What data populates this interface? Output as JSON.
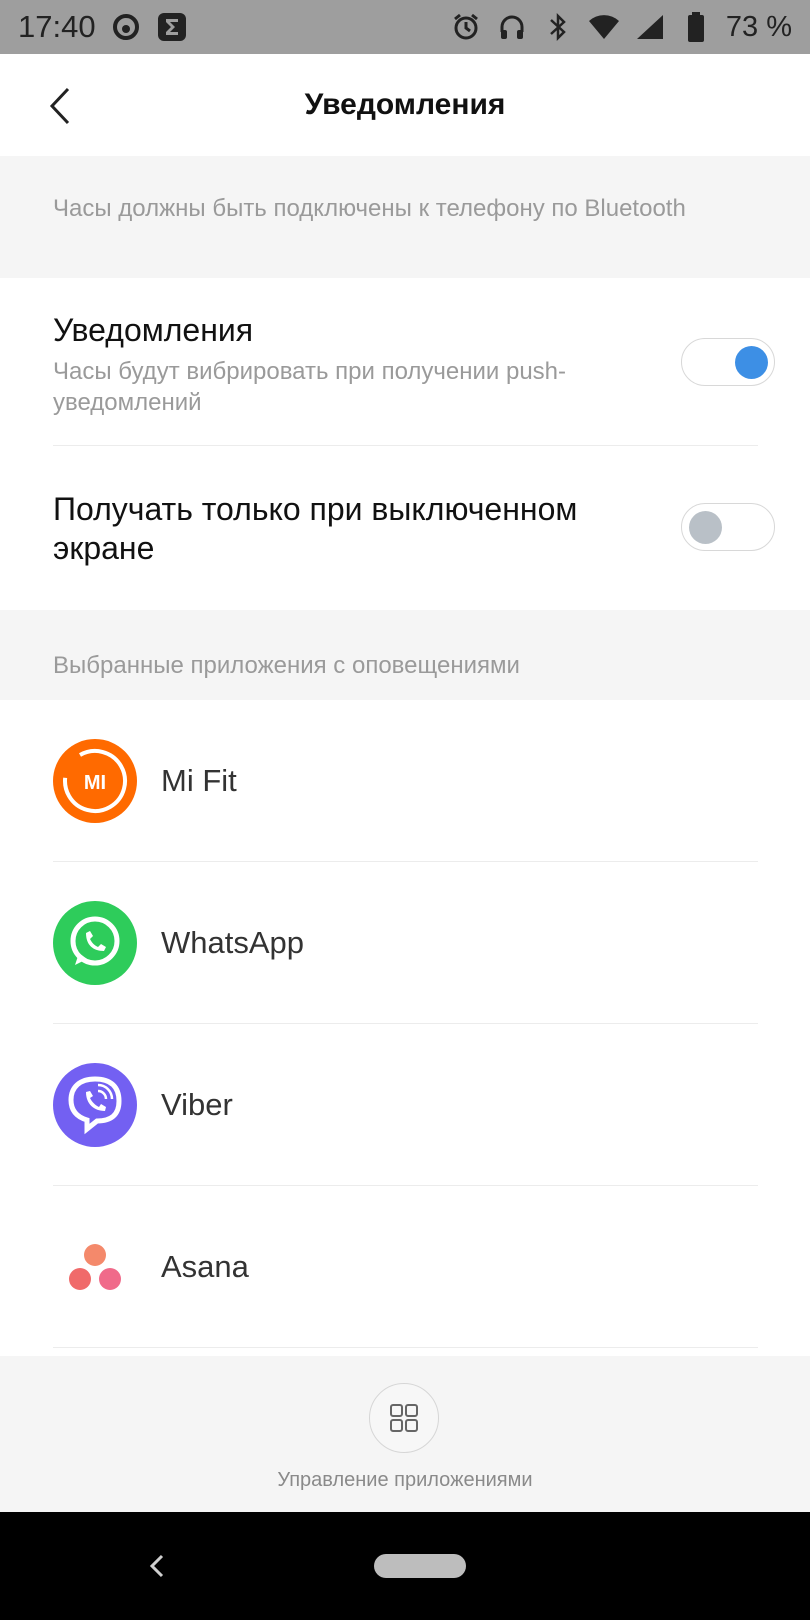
{
  "status_bar": {
    "time": "17:40",
    "battery_text": "73 %",
    "icons": [
      "threads-icon",
      "sigma-icon",
      "alarm-icon",
      "headphones-icon",
      "bluetooth-icon",
      "wifi-icon",
      "signal-icon",
      "battery-icon"
    ]
  },
  "header": {
    "title": "Уведомления",
    "back_icon": "chevron-left-icon"
  },
  "hints": {
    "bluetooth": "Часы должны быть подключены к телефону по Bluetooth",
    "selected_apps": "Выбранные приложения с оповещениями"
  },
  "settings": [
    {
      "title": "Уведомления",
      "description": "Часы будут вибрировать при получении push-уведомлений",
      "enabled": true
    },
    {
      "title": "Получать только при выключенном экране",
      "description": "",
      "enabled": false
    }
  ],
  "apps": [
    {
      "name": "Mi Fit",
      "icon": "mi-fit-icon",
      "color": "#ff6a00"
    },
    {
      "name": "WhatsApp",
      "icon": "whatsapp-icon",
      "color": "#2ecc5b"
    },
    {
      "name": "Viber",
      "icon": "viber-icon",
      "color": "#7360f2"
    },
    {
      "name": "Asana",
      "icon": "asana-icon",
      "color": "#f06a6a"
    }
  ],
  "manage": {
    "label": "Управление приложениями",
    "icon": "grid-icon"
  },
  "colors": {
    "accent": "#3d8fe5",
    "toggle_off": "#b9c0c7"
  }
}
